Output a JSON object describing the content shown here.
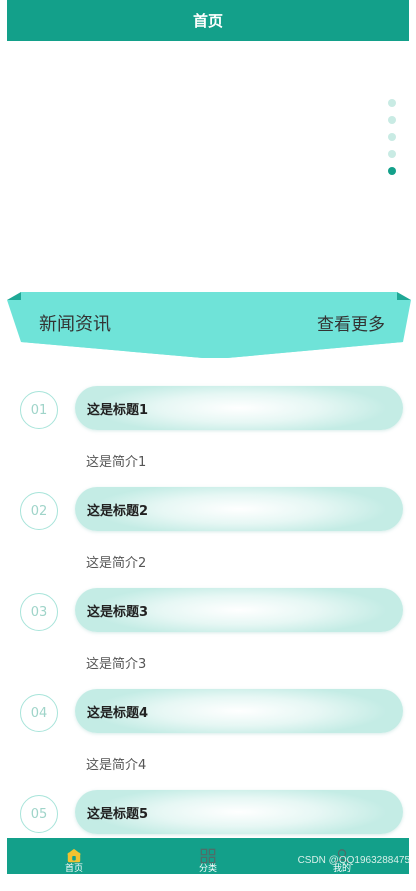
{
  "header": {
    "title": "首页"
  },
  "carousel": {
    "dot_count": 5,
    "active_index": 4
  },
  "news_section": {
    "title": "新闻资讯",
    "more_label": "查看更多"
  },
  "news": [
    {
      "num": "01",
      "title": "这是标题1",
      "summary": "这是简介1"
    },
    {
      "num": "02",
      "title": "这是标题2",
      "summary": "这是简介2"
    },
    {
      "num": "03",
      "title": "这是标题3",
      "summary": "这是简介3"
    },
    {
      "num": "04",
      "title": "这是标题4",
      "summary": "这是简介4"
    },
    {
      "num": "05",
      "title": "这是标题5",
      "summary": ""
    }
  ],
  "tabbar": {
    "tabs": [
      {
        "icon": "home-icon",
        "label": "首页",
        "active": true
      },
      {
        "icon": "grid-icon",
        "label": "分类",
        "active": false
      },
      {
        "icon": "user-icon",
        "label": "我的",
        "active": false
      }
    ]
  },
  "watermark": "CSDN @QQ1963288475",
  "colors": {
    "primary": "#13a08a",
    "ribbon": "#6fe3d8",
    "ribbon_dark": "#1fa896"
  }
}
